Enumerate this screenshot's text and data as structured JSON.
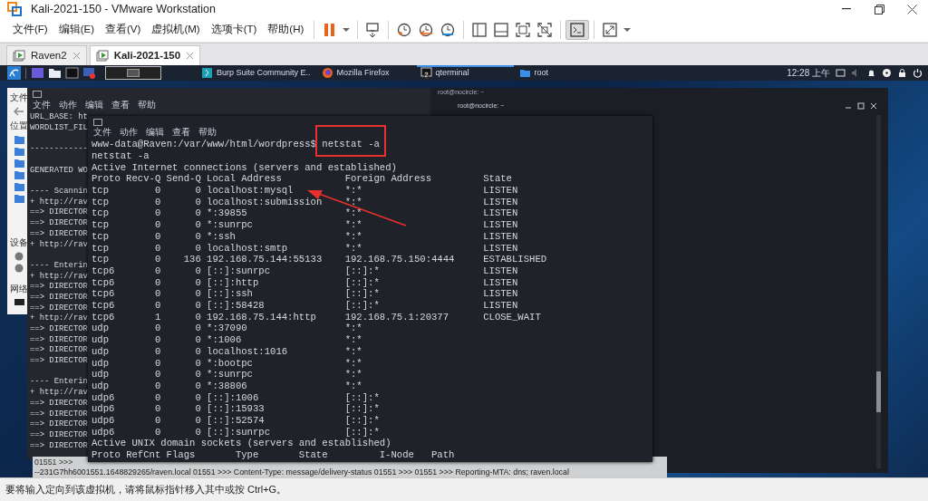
{
  "window": {
    "title": "Kali-2021-150 - VMware Workstation"
  },
  "menu": [
    "文件(F)",
    "编辑(E)",
    "查看(V)",
    "虚拟机(M)",
    "选项卡(T)",
    "帮助(H)"
  ],
  "toolbar": [
    [
      {
        "kind": "pause",
        "selected": false
      },
      {
        "kind": "caret",
        "selected": false
      }
    ],
    [
      {
        "kind": "send-keys",
        "selected": false
      }
    ],
    [
      {
        "kind": "snapshot-take",
        "selected": false
      },
      {
        "kind": "snapshot-revert",
        "selected": false
      },
      {
        "kind": "snapshot-manager",
        "selected": false
      }
    ],
    [
      {
        "kind": "library",
        "selected": false
      },
      {
        "kind": "thumbnail",
        "selected": false
      },
      {
        "kind": "fullscreen",
        "selected": false
      },
      {
        "kind": "unity",
        "selected": false
      }
    ],
    [
      {
        "kind": "console",
        "selected": true
      }
    ],
    [
      {
        "kind": "stretch",
        "selected": false
      },
      {
        "kind": "caret",
        "selected": false
      }
    ]
  ],
  "tabs": [
    {
      "label": "Raven2",
      "selected": false
    },
    {
      "label": "Kali-2021-150",
      "selected": true
    }
  ],
  "vm": {
    "panel": {
      "tasks": [
        {
          "kind": "burp",
          "label": "Burp Suite Community E..",
          "selected": false
        },
        {
          "kind": "firefox",
          "label": "Mozilla Firefox",
          "selected": false
        },
        {
          "kind": "terminal",
          "label": "qterminal",
          "badge": "2",
          "selected": true
        },
        {
          "kind": "folder",
          "label": "root",
          "selected": false
        }
      ],
      "clock": "12:28 上午"
    },
    "file_manager": {
      "menu": [
        "文件"
      ],
      "sections": [
        "位置",
        "设备",
        "网络"
      ]
    },
    "back_terminal": {
      "menu": [
        "文件",
        "动作",
        "编辑",
        "查看",
        "帮助"
      ],
      "blocks": [
        [
          "URL_BASE: ht",
          "WORDLIST_FIL"
        ],
        [
          "------------"
        ],
        [
          "GENERATED WO"
        ],
        [
          "---- Scannin",
          "+ http://rav",
          "==> DIRECTOR",
          "==> DIRECTOR",
          "==> DIRECTOR",
          "+ http://rav"
        ],
        [
          "---- Enterin",
          "+ http://rav",
          "==> DIRECTOR",
          "==> DIRECTOR",
          "==> DIRECTOR",
          "+ http://rav",
          "==> DIRECTOR",
          "==> DIRECTOR",
          "==> DIRECTOR",
          "==> DIRECTOR"
        ],
        [
          "---- Enterin",
          "+ http://rav",
          "==> DIRECTOR",
          "==> DIRECTOR",
          "==> DIRECTOR",
          "==> DIRECTOR",
          "==> DIRECTOR"
        ]
      ]
    },
    "right_terminal": {
      "title": "root@nocircle: ~",
      "tab_title": "root@nocircle: ~"
    },
    "front_terminal": {
      "menu": [
        "文件",
        "动作",
        "编辑",
        "查看",
        "帮助"
      ],
      "prompt": "www-data@Raven:/var/www/html/wordpress$",
      "command": "netstat -a",
      "command_highlighted": true,
      "echo": "netstat -a",
      "inet_title": "Active Internet connections (servers and established)",
      "inet_columns": [
        "Proto",
        "Recv-Q",
        "Send-Q",
        "Local Address",
        "Foreign Address",
        "State"
      ],
      "inet_rows": [
        {
          "proto": "tcp",
          "recv_q": "0",
          "send_q": "0",
          "local": "localhost:mysql",
          "foreign": "*:*",
          "state": "LISTEN"
        },
        {
          "proto": "tcp",
          "recv_q": "0",
          "send_q": "0",
          "local": "localhost:submission",
          "foreign": "*:*",
          "state": "LISTEN"
        },
        {
          "proto": "tcp",
          "recv_q": "0",
          "send_q": "0",
          "local": "*:39855",
          "foreign": "*:*",
          "state": "LISTEN"
        },
        {
          "proto": "tcp",
          "recv_q": "0",
          "send_q": "0",
          "local": "*:sunrpc",
          "foreign": "*:*",
          "state": "LISTEN"
        },
        {
          "proto": "tcp",
          "recv_q": "0",
          "send_q": "0",
          "local": "*:ssh",
          "foreign": "*:*",
          "state": "LISTEN"
        },
        {
          "proto": "tcp",
          "recv_q": "0",
          "send_q": "0",
          "local": "localhost:smtp",
          "foreign": "*:*",
          "state": "LISTEN"
        },
        {
          "proto": "tcp",
          "recv_q": "0",
          "send_q": "136",
          "local": "192.168.75.144:55133",
          "foreign": "192.168.75.150:4444",
          "state": "ESTABLISHED"
        },
        {
          "proto": "tcp6",
          "recv_q": "0",
          "send_q": "0",
          "local": "[::]:sunrpc",
          "foreign": "[::]:*",
          "state": "LISTEN"
        },
        {
          "proto": "tcp6",
          "recv_q": "0",
          "send_q": "0",
          "local": "[::]:http",
          "foreign": "[::]:*",
          "state": "LISTEN"
        },
        {
          "proto": "tcp6",
          "recv_q": "0",
          "send_q": "0",
          "local": "[::]:ssh",
          "foreign": "[::]:*",
          "state": "LISTEN"
        },
        {
          "proto": "tcp6",
          "recv_q": "0",
          "send_q": "0",
          "local": "[::]:58428",
          "foreign": "[::]:*",
          "state": "LISTEN"
        },
        {
          "proto": "tcp6",
          "recv_q": "1",
          "send_q": "0",
          "local": "192.168.75.144:http",
          "foreign": "192.168.75.1:20377",
          "state": "CLOSE_WAIT"
        },
        {
          "proto": "udp",
          "recv_q": "0",
          "send_q": "0",
          "local": "*:37090",
          "foreign": "*:*"
        },
        {
          "proto": "udp",
          "recv_q": "0",
          "send_q": "0",
          "local": "*:1006",
          "foreign": "*:*"
        },
        {
          "proto": "udp",
          "recv_q": "0",
          "send_q": "0",
          "local": "localhost:1016",
          "foreign": "*:*"
        },
        {
          "proto": "udp",
          "recv_q": "0",
          "send_q": "0",
          "local": "*:bootpc",
          "foreign": "*:*"
        },
        {
          "proto": "udp",
          "recv_q": "0",
          "send_q": "0",
          "local": "*:sunrpc",
          "foreign": "*:*"
        },
        {
          "proto": "udp",
          "recv_q": "0",
          "send_q": "0",
          "local": "*:38806",
          "foreign": "*:*"
        },
        {
          "proto": "udp6",
          "recv_q": "0",
          "send_q": "0",
          "local": "[::]:1006",
          "foreign": "[::]:*"
        },
        {
          "proto": "udp6",
          "recv_q": "0",
          "send_q": "0",
          "local": "[::]:15933",
          "foreign": "[::]:*"
        },
        {
          "proto": "udp6",
          "recv_q": "0",
          "send_q": "0",
          "local": "[::]:52574",
          "foreign": "[::]:*"
        },
        {
          "proto": "udp6",
          "recv_q": "0",
          "send_q": "0",
          "local": "[::]:sunrpc",
          "foreign": "[::]:*"
        }
      ],
      "unix_title": "Active UNIX domain sockets (servers and established)",
      "unix_columns": [
        "Proto",
        "RefCnt",
        "Flags",
        "Type",
        "State",
        "I-Node",
        "Path"
      ]
    },
    "mail_log": [
      "01551 >>>",
      "--231G7hh6001551.1648829265/raven.local 01551 >>> Content-Type: message/delivery-status 01551 >>> 01551 >>> Reporting-MTA: dns; raven.local"
    ]
  },
  "status_bar": "要将输入定向到该虚拟机，请将鼠标指针移入其中或按 Ctrl+G。"
}
